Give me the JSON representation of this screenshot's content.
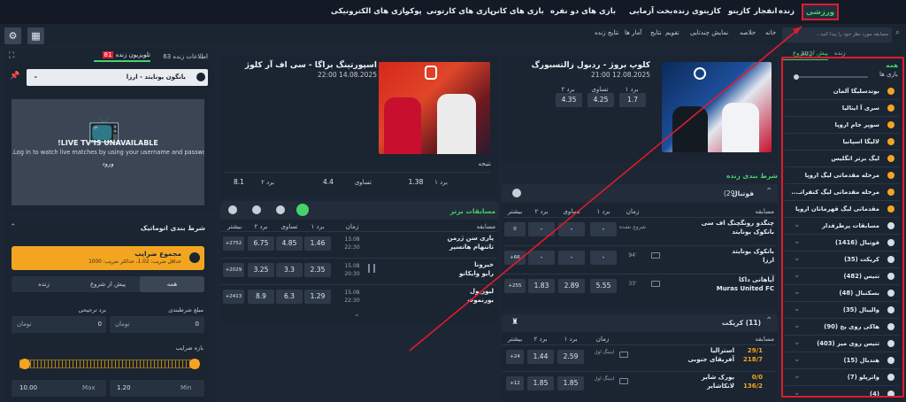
{
  "nav": {
    "items": [
      "ورزشی",
      "زنده",
      "انفجار",
      "کازینو",
      "کازینوی زنده",
      "بخت آزمایی",
      "بازی های دو نفره",
      "بازی های کانن",
      "بازی های کارتونی",
      "پوکر",
      "بازی های الکترونیکی"
    ]
  },
  "search": {
    "placeholder": "مسابقه مورد نظر خود را پیدا کنید..."
  },
  "breadcrumb": {
    "items": [
      "خانه",
      "خلاصه",
      "نمایش چندتایی",
      "تقویم",
      "نتایج",
      "آمار ها",
      "نتایج زنده"
    ]
  },
  "sidebar": {
    "tab_soon": "پیش از شروع",
    "tab_live": "زنده",
    "live_count": "302",
    "all_label": "همه",
    "games_label": "بازی ها",
    "items": [
      {
        "label": "بوندسلیگا آلمان",
        "chev": false
      },
      {
        "label": "سری آ ایتالیا",
        "chev": false
      },
      {
        "label": "سوپر جام اروپا",
        "chev": false
      },
      {
        "label": "لالیگا اسپانیا",
        "chev": false
      },
      {
        "label": "لیگ برتر انگلیس",
        "chev": false
      },
      {
        "label": "مرحله مقدماتی لیگ اروپا",
        "chev": false
      },
      {
        "label": "مرحله مقدماتی لیگ کنفرانـ...",
        "chev": false
      },
      {
        "label": "مقدماتی لیگ قهرمانان اروپا",
        "chev": false
      },
      {
        "label": "مسابقات پرطرفدار",
        "chev": true
      },
      {
        "label": "فوتبال (1416)",
        "chev": true
      },
      {
        "label": "کریکت (35)",
        "chev": true
      },
      {
        "label": "تنیس (482)",
        "chev": true
      },
      {
        "label": "بسکتبال (48)",
        "chev": true
      },
      {
        "label": "والیبال (35)",
        "chev": true
      },
      {
        "label": "هاکی روی یخ (90)",
        "chev": true
      },
      {
        "label": "تنیس روی میز (403)",
        "chev": true
      },
      {
        "label": "هندبال (15)",
        "chev": true
      },
      {
        "label": "واترپلو (7)",
        "chev": true
      },
      {
        "label": "(4)",
        "chev": true
      }
    ]
  },
  "featured1": {
    "title": "کلوپ بروژ - ردبول زالتسبورگ",
    "date": "12.08.2025 21:00",
    "h1": "برد ۱",
    "hx": "تساوی",
    "h2": "برد ۲",
    "o1": "1.7",
    "ox": "4.25",
    "o2": "4.35",
    "league": "CHAMPIONS LEAGUE"
  },
  "featured2": {
    "title": "اسپورتینگ براگا - سی اف آر کلوژ",
    "date": "14.08.2025 22:00",
    "result_label": "نتیجه",
    "h1": "برد ۱",
    "o1": "1.38",
    "hx": "تساوی",
    "ox": "4.4",
    "h2": "برد ۲",
    "o2": "8.1",
    "league": "EUROPA LEAGUE"
  },
  "live_section": {
    "title": "شرط بندی زنده"
  },
  "football": {
    "name": "فوتبال",
    "count": "(29)",
    "col_match": "مسابقه",
    "col_time": "زمان",
    "col_1": "برد ۱",
    "col_x": "تساوی",
    "col_2": "برد ۲",
    "col_more": "بیشتر",
    "rows": [
      {
        "t1": "چنگدو رونگچنگ اف سی",
        "t2": "بانکوک یونایتد",
        "time": "شروع نشده",
        "o1": "-",
        "ox": "-",
        "o2": "-",
        "more": "0"
      },
      {
        "t1": "بانکوک یونایتد",
        "t2": "ارزا",
        "time": "94'",
        "o1": "-",
        "ox": "-",
        "o2": "-",
        "more": "+66"
      },
      {
        "t1": "آپاهانی داکا",
        "t2": "Muras United FC",
        "time": "33'",
        "o1": "5.55",
        "ox": "2.89",
        "o2": "1.83",
        "more": "+255"
      }
    ]
  },
  "cricket": {
    "name": "کریکت",
    "count": "(11)",
    "col_match": "مسابقه",
    "col_time": "زمان",
    "col_1": "برد ۱",
    "col_2": "برد ۲",
    "col_more": "بیشتر",
    "rows": [
      {
        "t1": "استرالیا",
        "s1": "29/1",
        "t2": "آفریقای جنوبی",
        "s2": "218/7",
        "time": "اینینگ اول",
        "o1": "2.59",
        "o2": "1.44",
        "more": "+24"
      },
      {
        "t1": "یورک شایر",
        "s1": "0/0",
        "t2": "لانکاشایر",
        "s2": "136/2",
        "time": "اینینگ اول",
        "o1": "1.85",
        "o2": "1.85",
        "more": "+12"
      }
    ]
  },
  "top": {
    "title": "مسابقات برتر",
    "col_match": "مسابقه",
    "col_time": "زمان",
    "col_1": "برد ۱",
    "col_x": "تساوی",
    "col_2": "برد ۲",
    "col_more": "بیشتر",
    "rows": [
      {
        "t1": "پاری سن ژرمن",
        "t2": "تاتنهام هاتسپر",
        "time": "13.08 22:30",
        "o1": "1.46",
        "ox": "4.85",
        "o2": "6.75",
        "more": "+2752"
      },
      {
        "t1": "خیرونا",
        "t2": "رایو وایکانو",
        "time": "15.08 20:30",
        "o1": "2.35",
        "ox": "3.3",
        "o2": "3.25",
        "more": "+2029"
      },
      {
        "t1": "لیورپول",
        "t2": "بورنموث",
        "time": "15.08 22:30",
        "o1": "1.29",
        "ox": "6.3",
        "o2": "8.9",
        "more": "+2413"
      }
    ]
  },
  "rightpanel": {
    "info_label": "اطلاعات زنده",
    "info_count": "63",
    "tv_label": "تلویزیون زنده",
    "tv_count": "81",
    "match_select": "بانگون یونایتد - ارزا",
    "tv_title": "!LIVE TV IS UNAVAILABLE",
    "tv_text": ".Log in to watch live matches by using your username and password",
    "tv_login": "ورود"
  },
  "autobet": {
    "title": "شرط بندی اتوماتیک",
    "box_title": "مجموع ضرایب",
    "box_sub": "حداقل ضریب: 1.02، حداکثر ضریب: 1000",
    "tabs": [
      "همه",
      "پیش از شروع",
      "زنده"
    ],
    "stake_label": "مبلغ شرطبندی",
    "win_label": "برد ترجیحی",
    "stake_value": "0",
    "win_value": "0",
    "currency": "تومان",
    "range_label": "بازه ضرایب",
    "min_label": "Min",
    "min_value": "1.20",
    "max_label": "Max",
    "max_value": "10.00"
  },
  "colors": {
    "accent_green": "#46d26b",
    "highlight_red": "#e21b2c",
    "gold": "#f3a521"
  }
}
